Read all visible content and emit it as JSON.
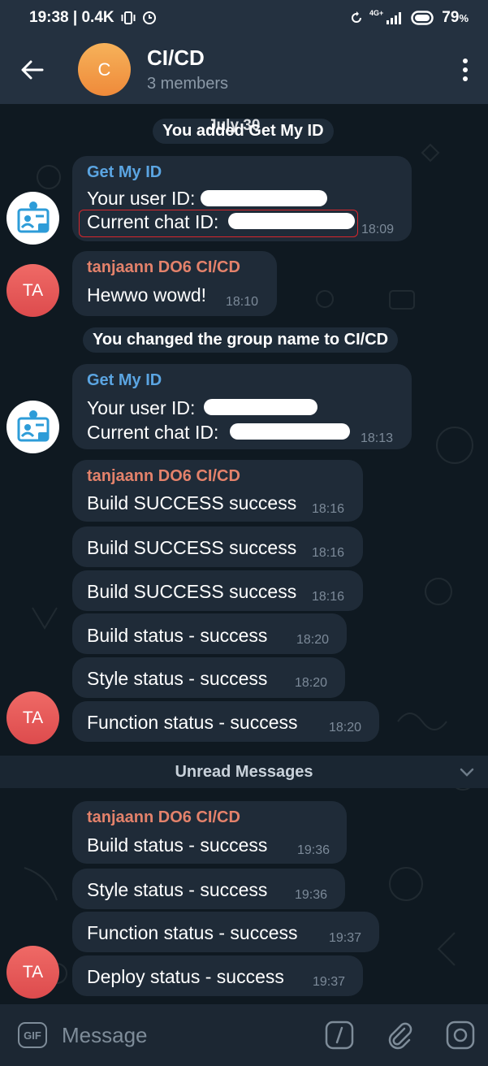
{
  "status_bar": {
    "time_speed": "19:38 | 0.4K",
    "network": "4G+",
    "battery": "79",
    "battery_unit": "%"
  },
  "header": {
    "avatar_letter": "C",
    "title": "CI/CD",
    "subtitle": "3 members",
    "avatar_color": "#f0a04b"
  },
  "chat": {
    "date_chip": "July 30",
    "service_added": "You added Get My ID",
    "service_renamed": "You changed the group name to CI/CD",
    "unread_label": "Unread Messages",
    "bot_name": "Get My ID",
    "user_name": "tanjaann DO6 CI/CD",
    "user_initials": "TA",
    "messages": [
      {
        "text": "Your user ID:",
        "text2": "Current chat ID:",
        "time": "18:09"
      },
      {
        "text": "Hewwo wowd!",
        "time": "18:10"
      },
      {
        "text": "Your user ID:",
        "text2": "Current chat ID:",
        "time": "18:13"
      },
      {
        "text": "Build SUCCESS success",
        "time": "18:16"
      },
      {
        "text": "Build SUCCESS success",
        "time": "18:16"
      },
      {
        "text": "Build SUCCESS success",
        "time": "18:16"
      },
      {
        "text": "Build status -  success",
        "time": "18:20"
      },
      {
        "text": "Style status -  success",
        "time": "18:20"
      },
      {
        "text": "Function status -  success",
        "time": "18:20"
      },
      {
        "text": "Build status -  success",
        "time": "19:36"
      },
      {
        "text": "Style status -  success",
        "time": "19:36"
      },
      {
        "text": "Function status -  success",
        "time": "19:37"
      },
      {
        "text": "Deploy status -  success",
        "time": "19:37"
      }
    ]
  },
  "input": {
    "gif_label": "GIF",
    "placeholder": "Message"
  },
  "colors": {
    "bot_name": "#5ba5e2",
    "user_name": "#e4826b",
    "bubble": "#1f2b38",
    "background": "#0f1921"
  }
}
